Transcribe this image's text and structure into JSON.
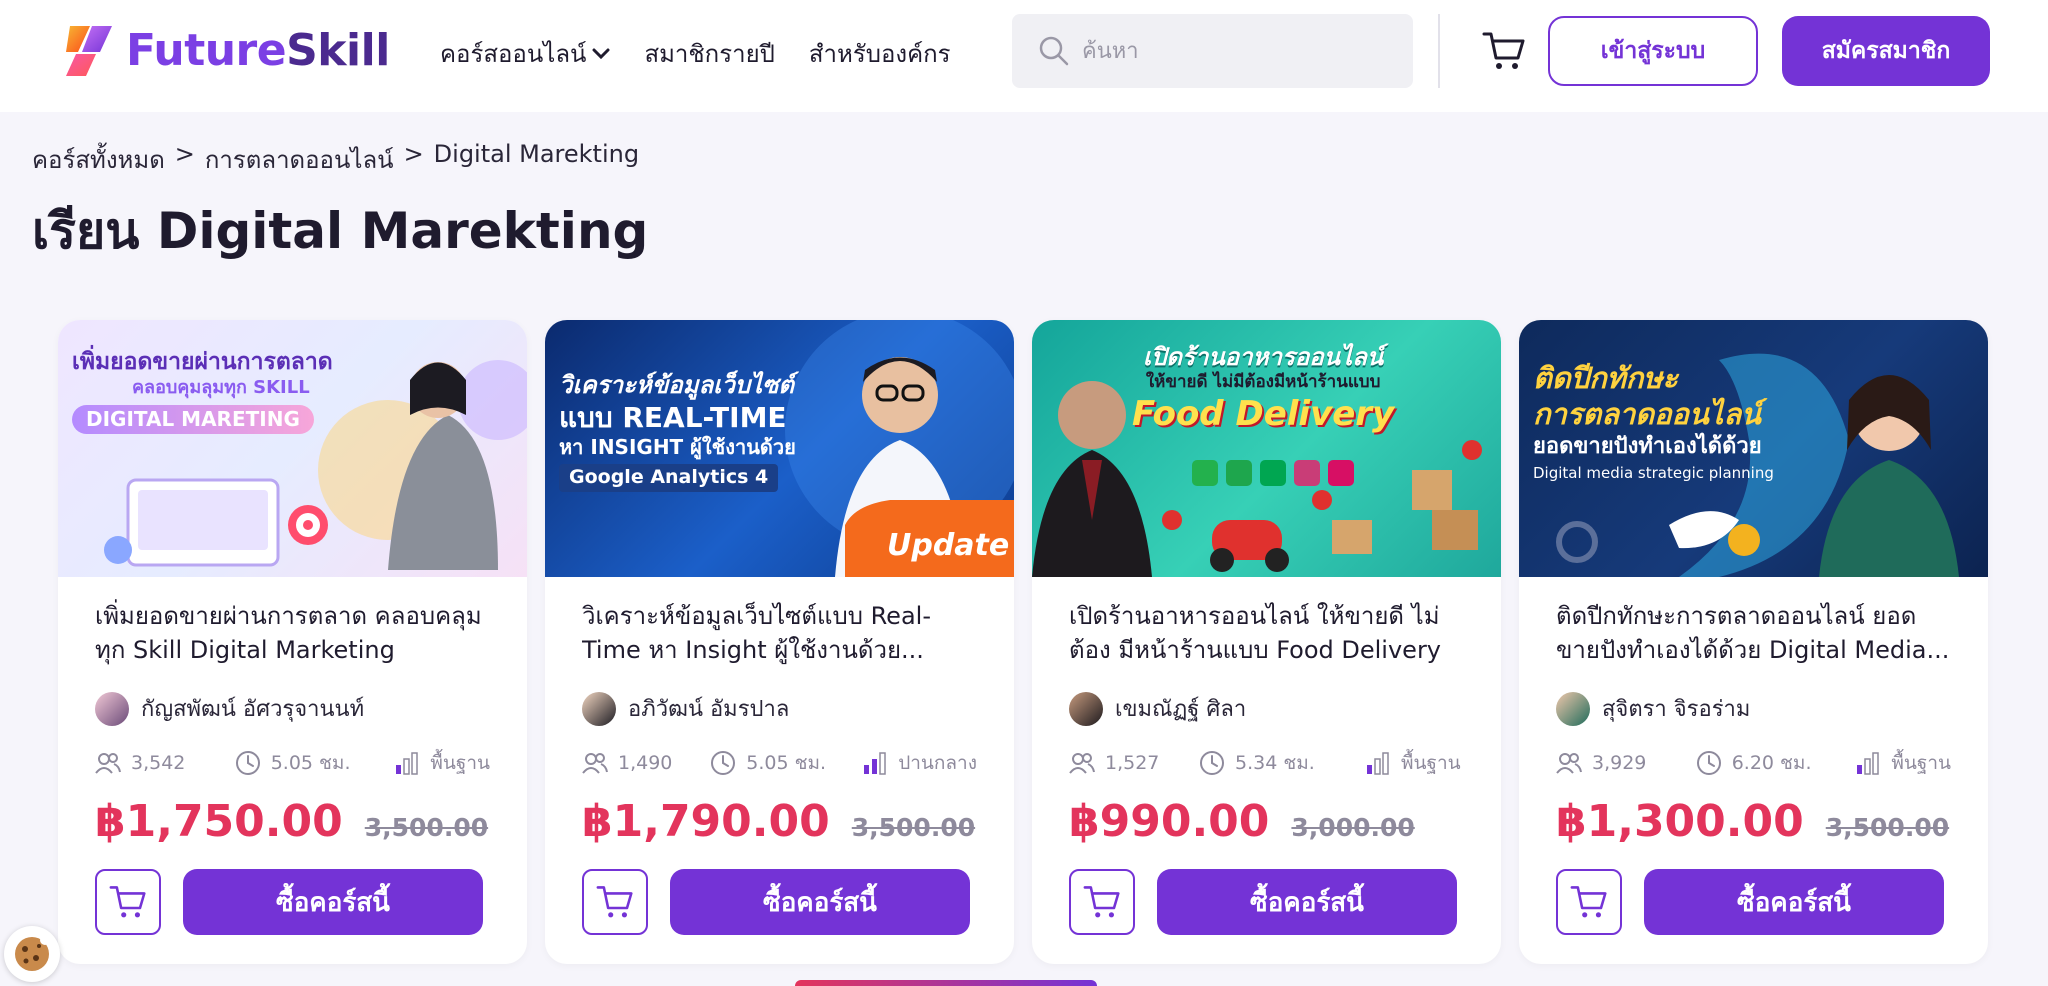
{
  "header": {
    "logo": {
      "part1": "Future",
      "part2": "Skill"
    },
    "nav": [
      {
        "label": "คอร์สออนไลน์"
      },
      {
        "label": "สมาชิกรายปี"
      },
      {
        "label": "สำหรับองค์กร"
      }
    ],
    "search_placeholder": "ค้นหา",
    "login_label": "เข้าสู่ระบบ",
    "register_label": "สมัครสมาชิก"
  },
  "breadcrumb": {
    "items": [
      "คอร์สทั้งหมด",
      "การตลาดออนไลน์",
      "Digital Marekting"
    ],
    "separator": ">"
  },
  "page_title": "เรียน Digital Marekting",
  "courses": [
    {
      "banner": {
        "line1": "เพิ่มยอดขายผ่านการตลาด",
        "line2": "คลอบคุมลุมทุก SKILL",
        "line3": "DIGITAL MARETING"
      },
      "title": "เพิ่มยอดขายผ่านการตลาด คลอบคลุม ทุก Skill Digital Marketing",
      "instructor": "กัญสพัฒน์ อัศวรุจานนท์",
      "students": "3,542",
      "duration": "5.05 ชม.",
      "level": "พื้นฐาน",
      "price": "฿1,750.00",
      "old_price": "3,500.00",
      "buy_label": "ซื้อคอร์สนี้"
    },
    {
      "banner": {
        "line1": "วิเคราะห์ข้อมูลเว็บไซต์",
        "line2": "แบบ REAL-TIME",
        "line3": "หา INSIGHT ผู้ใช้งานด้วย",
        "line4": "Google Analytics 4",
        "badge": "Update"
      },
      "title": "วิเคราะห์ข้อมูลเว็บไซต์แบบ Real-Time หา Insight ผู้ใช้งานด้วย...",
      "instructor": "อภิวัฒน์ อัมรปาล",
      "students": "1,490",
      "duration": "5.05 ชม.",
      "level": "ปานกลาง",
      "price": "฿1,790.00",
      "old_price": "3,500.00",
      "buy_label": "ซื้อคอร์สนี้"
    },
    {
      "banner": {
        "line1": "เปิดร้านอาหารออนไลน์",
        "line2": "ให้ขายดี ไม่มีต้องมีหน้าร้านแบบ",
        "line3": "Food Delivery"
      },
      "title": "เปิดร้านอาหารออนไลน์ ให้ขายดี ไม่ต้อง มีหน้าร้านแบบ Food Delivery",
      "instructor": "เขมณัฏฐ์ ศิลา",
      "students": "1,527",
      "duration": "5.34 ชม.",
      "level": "พื้นฐาน",
      "price": "฿990.00",
      "old_price": "3,000.00",
      "buy_label": "ซื้อคอร์สนี้"
    },
    {
      "banner": {
        "line1": "ติดปีกทักษะ",
        "line2": "การตลาดออนไลน์",
        "line3": "ยอดขายปังทำเองได้ด้วย",
        "line4": "Digital media strategic planning"
      },
      "title": "ติดปีกทักษะการตลาดออนไลน์ ยอด ขายปังทำเองได้ด้วย Digital Media...",
      "instructor": "สุจิตรา จิรอร่าม",
      "students": "3,929",
      "duration": "6.20 ชม.",
      "level": "พื้นฐาน",
      "price": "฿1,300.00",
      "old_price": "3,500.00",
      "buy_label": "ซื้อคอร์สนี้"
    }
  ],
  "icons": {
    "search": "search-icon",
    "cart": "cart-icon",
    "students": "users-icon",
    "duration": "clock-icon",
    "level": "level-bars-icon",
    "cookie": "cookie-icon"
  },
  "colors": {
    "brand": "#7433d6",
    "price": "#e3345c",
    "muted": "#8e8a9c"
  }
}
